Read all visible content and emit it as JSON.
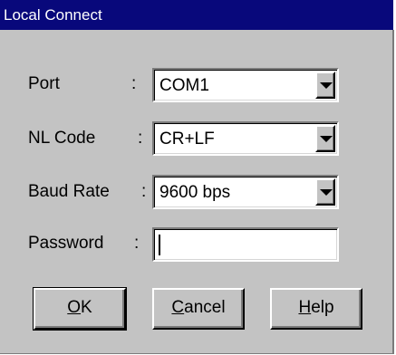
{
  "window": {
    "title": "Local Connect"
  },
  "form": {
    "port": {
      "label": "Port",
      "colon": ":",
      "value": "COM1"
    },
    "nl_code": {
      "label": "NL Code",
      "colon": ":",
      "value": "CR+LF"
    },
    "baud_rate": {
      "label": "Baud Rate",
      "colon": ":",
      "value": "9600 bps"
    },
    "password": {
      "label": "Password",
      "colon": ":",
      "value": ""
    }
  },
  "buttons": {
    "ok": {
      "hotkey": "O",
      "rest": "K"
    },
    "cancel": {
      "hotkey": "C",
      "rest": "ancel"
    },
    "help": {
      "hotkey": "H",
      "rest": "elp"
    }
  },
  "colors": {
    "titlebar": "#08087b",
    "face": "#c3c3c3"
  },
  "icons": {
    "dropdown": "chevron-down-icon"
  }
}
